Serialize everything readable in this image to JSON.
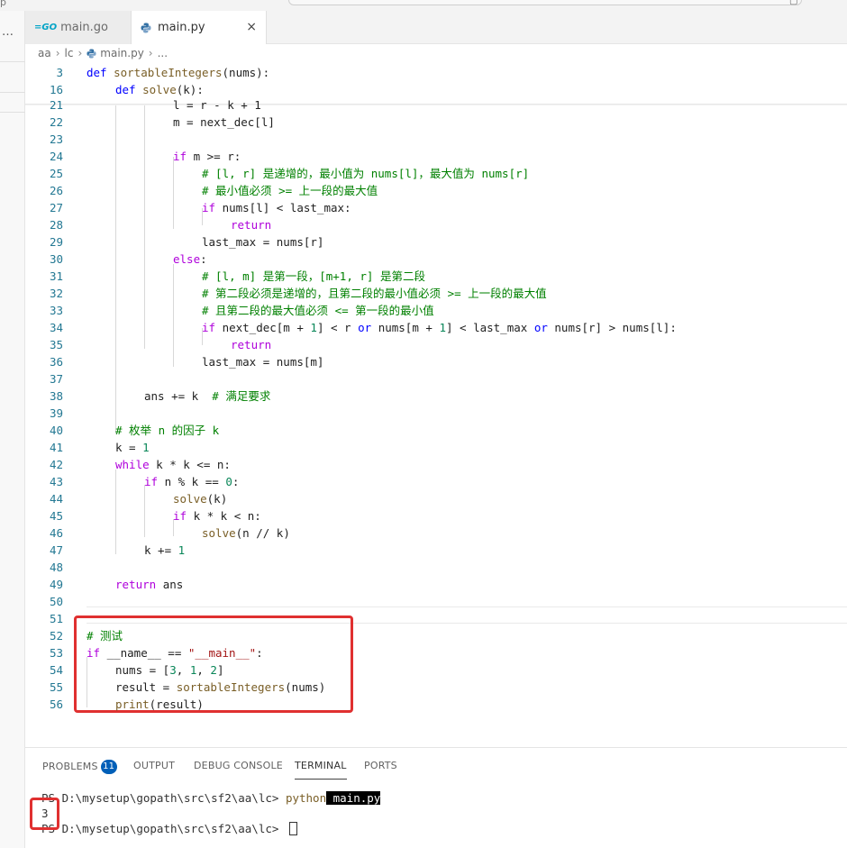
{
  "tabs": [
    {
      "label": "main.go",
      "icon": "go-icon",
      "active": false
    },
    {
      "label": "main.py",
      "icon": "python-icon",
      "active": true,
      "close": "×"
    }
  ],
  "breadcrumb": [
    "aa",
    "lc",
    "main.py",
    "..."
  ],
  "colors": {
    "keyword": "#0000ff",
    "control": "#af00db",
    "function": "#795e26",
    "comment": "#008000",
    "number": "#098658",
    "string": "#a31515",
    "line_number": "#237893",
    "highlight": "#e03030",
    "badge": "#005fb8"
  },
  "code_lines": [
    {
      "n": "3",
      "indent": 0,
      "tokens": [
        {
          "t": "def ",
          "c": "kw"
        },
        {
          "t": "sortableIntegers",
          "c": "fn"
        },
        {
          "t": "(nums):"
        }
      ]
    },
    {
      "n": "16",
      "indent": 4,
      "tokens": [
        {
          "t": "def ",
          "c": "kw"
        },
        {
          "t": "solve",
          "c": "fn"
        },
        {
          "t": "(k):"
        }
      ]
    },
    {
      "n": "21",
      "indent": 12,
      "tokens": [
        {
          "t": "l = r - k + 1"
        }
      ]
    },
    {
      "n": "22",
      "indent": 12,
      "tokens": [
        {
          "t": "m = next_dec[l]"
        }
      ]
    },
    {
      "n": "23",
      "indent": 0,
      "tokens": []
    },
    {
      "n": "24",
      "indent": 12,
      "tokens": [
        {
          "t": "if ",
          "c": "ctl"
        },
        {
          "t": "m >= r:"
        }
      ]
    },
    {
      "n": "25",
      "indent": 16,
      "tokens": [
        {
          "t": "# [l, r] 是递增的，最小值为 nums[l]，最大值为 nums[r]",
          "c": "cm"
        }
      ]
    },
    {
      "n": "26",
      "indent": 16,
      "tokens": [
        {
          "t": "# 最小值必须 >= 上一段的最大值",
          "c": "cm"
        }
      ]
    },
    {
      "n": "27",
      "indent": 16,
      "tokens": [
        {
          "t": "if ",
          "c": "ctl"
        },
        {
          "t": "nums[l] < last_max:"
        }
      ]
    },
    {
      "n": "28",
      "indent": 20,
      "tokens": [
        {
          "t": "return",
          "c": "ctl"
        }
      ]
    },
    {
      "n": "29",
      "indent": 16,
      "tokens": [
        {
          "t": "last_max = nums[r]"
        }
      ]
    },
    {
      "n": "30",
      "indent": 12,
      "tokens": [
        {
          "t": "else",
          "c": "ctl"
        },
        {
          "t": ":"
        }
      ]
    },
    {
      "n": "31",
      "indent": 16,
      "tokens": [
        {
          "t": "# [l, m] 是第一段，[m+1, r] 是第二段",
          "c": "cm"
        }
      ]
    },
    {
      "n": "32",
      "indent": 16,
      "tokens": [
        {
          "t": "# 第二段必须是递增的，且第二段的最小值必须 >= 上一段的最大值",
          "c": "cm"
        }
      ]
    },
    {
      "n": "33",
      "indent": 16,
      "tokens": [
        {
          "t": "# 且第二段的最大值必须 <= 第一段的最小值",
          "c": "cm"
        }
      ]
    },
    {
      "n": "34",
      "indent": 16,
      "tokens": [
        {
          "t": "if ",
          "c": "ctl"
        },
        {
          "t": "next_dec[m + "
        },
        {
          "t": "1",
          "c": "num"
        },
        {
          "t": "] < r "
        },
        {
          "t": "or",
          "c": "kw"
        },
        {
          "t": " nums[m + "
        },
        {
          "t": "1",
          "c": "num"
        },
        {
          "t": "] < last_max "
        },
        {
          "t": "or",
          "c": "kw"
        },
        {
          "t": " nums[r] > nums[l]:"
        }
      ]
    },
    {
      "n": "35",
      "indent": 20,
      "tokens": [
        {
          "t": "return",
          "c": "ctl"
        }
      ]
    },
    {
      "n": "36",
      "indent": 16,
      "tokens": [
        {
          "t": "last_max = nums[m]"
        }
      ]
    },
    {
      "n": "37",
      "indent": 0,
      "tokens": []
    },
    {
      "n": "38",
      "indent": 8,
      "tokens": [
        {
          "t": "ans += k  "
        },
        {
          "t": "# 满足要求",
          "c": "cm"
        }
      ]
    },
    {
      "n": "39",
      "indent": 0,
      "tokens": []
    },
    {
      "n": "40",
      "indent": 4,
      "tokens": [
        {
          "t": "# 枚举 n 的因子 k",
          "c": "cm"
        }
      ]
    },
    {
      "n": "41",
      "indent": 4,
      "tokens": [
        {
          "t": "k = "
        },
        {
          "t": "1",
          "c": "num"
        }
      ]
    },
    {
      "n": "42",
      "indent": 4,
      "tokens": [
        {
          "t": "while ",
          "c": "ctl"
        },
        {
          "t": "k * k <= n:"
        }
      ]
    },
    {
      "n": "43",
      "indent": 8,
      "tokens": [
        {
          "t": "if ",
          "c": "ctl"
        },
        {
          "t": "n % k == "
        },
        {
          "t": "0",
          "c": "num"
        },
        {
          "t": ":"
        }
      ]
    },
    {
      "n": "44",
      "indent": 12,
      "tokens": [
        {
          "t": "solve",
          "c": "fn"
        },
        {
          "t": "(k)"
        }
      ]
    },
    {
      "n": "45",
      "indent": 12,
      "tokens": [
        {
          "t": "if ",
          "c": "ctl"
        },
        {
          "t": "k * k < n:"
        }
      ]
    },
    {
      "n": "46",
      "indent": 16,
      "tokens": [
        {
          "t": "solve",
          "c": "fn"
        },
        {
          "t": "(n // k)"
        }
      ]
    },
    {
      "n": "47",
      "indent": 8,
      "tokens": [
        {
          "t": "k += "
        },
        {
          "t": "1",
          "c": "num"
        }
      ]
    },
    {
      "n": "48",
      "indent": 0,
      "tokens": []
    },
    {
      "n": "49",
      "indent": 4,
      "tokens": [
        {
          "t": "return ",
          "c": "ctl"
        },
        {
          "t": "ans"
        }
      ]
    },
    {
      "n": "50",
      "indent": 0,
      "tokens": []
    },
    {
      "n": "51",
      "indent": 0,
      "tokens": []
    },
    {
      "n": "52",
      "indent": 0,
      "tokens": [
        {
          "t": "# 测试",
          "c": "cm"
        }
      ]
    },
    {
      "n": "53",
      "indent": 0,
      "tokens": [
        {
          "t": "if ",
          "c": "ctl"
        },
        {
          "t": "__name__ == "
        },
        {
          "t": "\"__main__\"",
          "c": "str"
        },
        {
          "t": ":"
        }
      ]
    },
    {
      "n": "54",
      "indent": 4,
      "tokens": [
        {
          "t": "nums = ["
        },
        {
          "t": "3",
          "c": "num"
        },
        {
          "t": ", "
        },
        {
          "t": "1",
          "c": "num"
        },
        {
          "t": ", "
        },
        {
          "t": "2",
          "c": "num"
        },
        {
          "t": "]"
        }
      ]
    },
    {
      "n": "55",
      "indent": 4,
      "tokens": [
        {
          "t": "result = "
        },
        {
          "t": "sortableIntegers",
          "c": "fn"
        },
        {
          "t": "(nums)"
        }
      ]
    },
    {
      "n": "56",
      "indent": 4,
      "tokens": [
        {
          "t": "print",
          "c": "fn"
        },
        {
          "t": "(result)"
        }
      ]
    }
  ],
  "panel": {
    "tabs": [
      {
        "label": "PROBLEMS",
        "badge": "11"
      },
      {
        "label": "OUTPUT"
      },
      {
        "label": "DEBUG CONSOLE"
      },
      {
        "label": "TERMINAL",
        "active": true
      },
      {
        "label": "PORTS"
      }
    ],
    "terminal": {
      "line1_prompt": "PS D:\\mysetup\\gopath\\src\\sf2\\aa\\lc> ",
      "line1_cmd": "python",
      "line1_arg": " main.py",
      "output": "3",
      "line3_prompt": "PS D:\\mysetup\\gopath\\src\\sf2\\aa\\lc> "
    }
  }
}
